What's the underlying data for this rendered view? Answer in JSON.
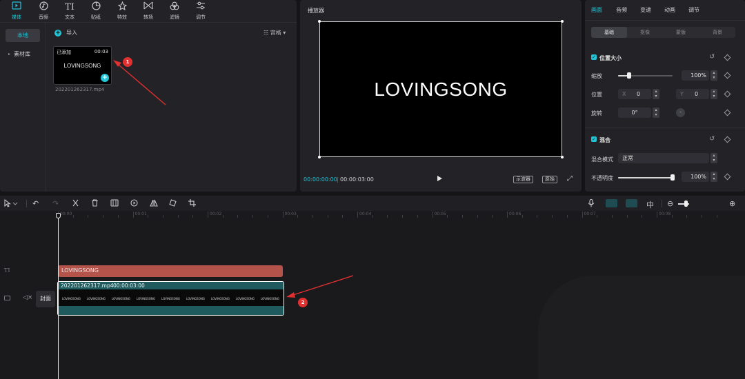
{
  "toolbar": {
    "items": [
      {
        "label": "媒体",
        "icon": "media-icon"
      },
      {
        "label": "音频",
        "icon": "audio-icon"
      },
      {
        "label": "文本",
        "icon": "text-icon"
      },
      {
        "label": "贴纸",
        "icon": "sticker-icon"
      },
      {
        "label": "特效",
        "icon": "effects-icon"
      },
      {
        "label": "转场",
        "icon": "transition-icon"
      },
      {
        "label": "滤镜",
        "icon": "filter-icon"
      },
      {
        "label": "调节",
        "icon": "adjust-icon"
      }
    ]
  },
  "media_panel": {
    "nav_local": "本地",
    "nav_library": "素材库",
    "import_label": "导入",
    "view_mode": "宫格",
    "clip": {
      "status": "已添加",
      "duration": "00:03",
      "title": "LOVINGSONG",
      "filename": "202201262317.mp4"
    }
  },
  "player": {
    "title": "播放器",
    "canvas_text": "LOVINGSONG",
    "current_time": "00:00:00:00",
    "total_time": "00:00:03:00",
    "btn_scope": "示波器",
    "btn_original": "原始"
  },
  "inspector": {
    "tabs": [
      "画面",
      "音频",
      "变速",
      "动画",
      "调节"
    ],
    "subtabs": [
      "基础",
      "抠像",
      "蒙版",
      "背景"
    ],
    "position_size": {
      "title": "位置大小",
      "scale_label": "缩放",
      "scale_value": "100%",
      "scale_fraction": 0.2,
      "position_label": "位置",
      "x_label": "X",
      "x_value": "0",
      "y_label": "Y",
      "y_value": "0",
      "rotation_label": "旋转",
      "rotation_value": "0°",
      "rotation_knob": "-"
    },
    "blend": {
      "title": "混合",
      "mode_label": "混合模式",
      "mode_value": "正常",
      "opacity_label": "不透明度",
      "opacity_value": "100%",
      "opacity_fraction": 1.0
    }
  },
  "timeline": {
    "ruler": [
      "00:00",
      "00:01",
      "00:02",
      "00:03",
      "00:04",
      "00:05",
      "00:06",
      "00:07",
      "00:08"
    ],
    "text_clip": "LOVINGSONG",
    "video_clip_name": "202201262317.mp4",
    "video_clip_duration": "00:00:03:00",
    "frame_text": "LOVINGSONG",
    "cover_label": "封面",
    "annotation_1": "1",
    "annotation_2": "2"
  },
  "colors": {
    "accent": "#22c4d6",
    "text_clip": "#b4534a",
    "video_clip": "#1f5b5e",
    "annotation": "#e0302f"
  }
}
